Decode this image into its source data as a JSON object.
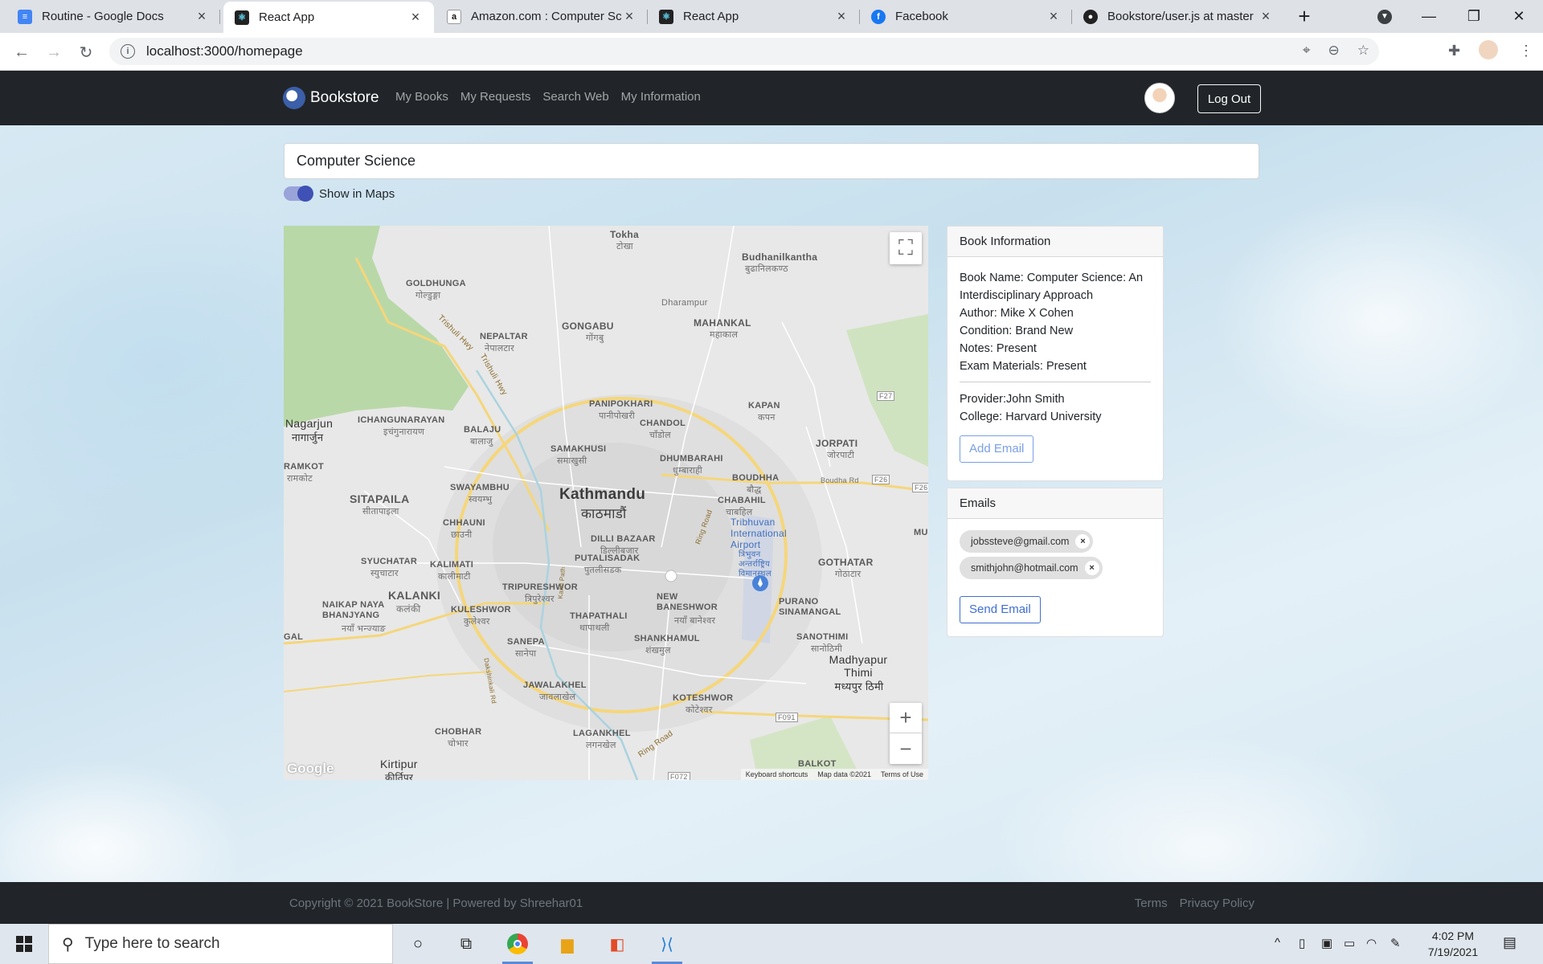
{
  "browser": {
    "tabs": [
      {
        "title": "Routine - Google Docs",
        "icon": "google-docs-icon",
        "color": "#4285f4"
      },
      {
        "title": "React App",
        "icon": "react-icon",
        "color": "#222222"
      },
      {
        "title": "Amazon.com : Computer Sc",
        "icon": "amazon-icon",
        "color": "#222222"
      },
      {
        "title": "React App",
        "icon": "react-icon",
        "color": "#222222"
      },
      {
        "title": "Facebook",
        "icon": "facebook-icon",
        "color": "#1877f2"
      },
      {
        "title": "Bookstore/user.js at master",
        "icon": "github-icon",
        "color": "#222222"
      }
    ],
    "url": "localhost:3000/homepage"
  },
  "nav": {
    "brand": "Bookstore",
    "links": [
      "My Books",
      "My Requests",
      "Search Web",
      "My Information"
    ],
    "logout": "Log Out"
  },
  "search": {
    "value": "Computer Science"
  },
  "toggle": {
    "label": "Show in Maps",
    "on": true
  },
  "map": {
    "labels": {
      "tokha": "Tokha",
      "tokha_dev": "टोखा",
      "budhanilkantha": "Budhanilkantha",
      "budhanilkantha_dev": "बुढानिलकण्ठ",
      "goldhunga": "GOLDHUNGA",
      "goldhunga_dev": "गोल्डुङ्गा",
      "dharampur": "Dharampur",
      "gongabu": "GONGABU",
      "gongabu_dev": "गोंगबु",
      "mahankal": "MAHANKAL",
      "mahankal_dev": "महाकाल",
      "nepaltar": "NEPALTAR",
      "nepaltar_dev": "नेपालटार",
      "trishuli1": "Trishuli Hwy",
      "trishuli2": "Trishuli Hwy",
      "panipokhari": "PANIPOKHARI",
      "panipokhari_dev": "पानीपोखरी",
      "kapan": "KAPAN",
      "kapan_dev": "कपन",
      "f27": "F27",
      "nagarjun": "Nagarjun",
      "nagarjun_dev": "नागार्जुन",
      "ichangunarayan": "ICHANGUNARAYAN",
      "ichangunarayan_dev": "इचंगुनारायण",
      "balaju": "BALAJU",
      "balaju_dev": "बालाजु",
      "chandol": "CHANDOL",
      "chandol_dev": "चाँडोल",
      "jorpati": "JORPATI",
      "jorpati_dev": "जोरपाटी",
      "samakhusi": "SAMAKHUSI",
      "samakhusi_dev": "समाखुसी",
      "dhumbarahi": "DHUMBARAHI",
      "dhumbarahi_dev": "धुम्बाराही",
      "ramkot": "RAMKOT",
      "ramkot_dev": "रामकोट",
      "swayambhu": "SWAYAMBHU",
      "swayambhu_dev": "स्वयम्भु",
      "boudhha": "BOUDHHA",
      "boudhha_dev": "बौद्ध",
      "boudha_rd": "Boudha Rd",
      "f26": "F26",
      "f26b": "F26",
      "kathmandu": "Kathmandu",
      "kathmandu_dev": "काठमाडौं",
      "sitapaila": "SITAPAILA",
      "sitapaila_dev": "सीतापाइला",
      "chabahil": "CHABAHIL",
      "chabahil_dev": "चाबहिल",
      "airport": "Tribhuvan International Airport",
      "airport_dev": "त्रिभुवन अन्तर्राष्ट्रिय विमानस्थल",
      "chhauni": "CHHAUNI",
      "chhauni_dev": "छाउनी",
      "dilli_bazaar": "DILLI BAZAAR",
      "dilli_bazaar_dev": "डिल्लीबजार",
      "mu": "MU",
      "syuchatar": "SYUCHATAR",
      "syuchatar_dev": "स्युचाटार",
      "kalimati": "KALIMATI",
      "kalimati_dev": "कालीमाटी",
      "putalisadak": "PUTALISADAK",
      "putalisadak_dev": "पुतलीसडक",
      "gothatar": "GOTHATAR",
      "gothatar_dev": "गोठाटार",
      "kalanki": "KALANKI",
      "kalanki_dev": "कलंकी",
      "tripureshwor": "TRIPURESHWOR",
      "tripureshwor_dev": "त्रिपुरेश्वर",
      "naikap": "NAIKAP NAYA BHANJYANG",
      "naikap_dev": "नयाँ भन्ज्याङ",
      "kuleshwor": "KULESHWOR",
      "kuleshwor_dev": "कुलेश्वर",
      "new_baneshwor": "NEW BANESHWOR",
      "new_baneshwor_dev": "नयाँ बानेश्वर",
      "purano": "PURANO SINAMANGAL",
      "thapathali": "THAPATHALI",
      "thapathali_dev": "थापाथली",
      "gal": "GAL",
      "sanepa": "SANEPA",
      "sanepa_dev": "सानेपा",
      "shankhamul": "SHANKHAMUL",
      "shankhamul_dev": "शंखमुल",
      "sanothimi": "SANOTHIMI",
      "sanothimi_dev": "सानोठिमी",
      "madhyapur": "Madhyapur Thimi",
      "madhyapur_dev": "मध्यपुर ठिमी",
      "jawalakhel": "JAWALAKHEL",
      "jawalakhel_dev": "जावलाखेल",
      "koteshwor": "KOTESHWOR",
      "koteshwor_dev": "कोटेश्वर",
      "f091": "F091",
      "f072": "F072",
      "chobhar": "CHOBHAR",
      "chobhar_dev": "चोभार",
      "lagankhel": "LAGANKHEL",
      "lagankhel_dev": "लगनखेल",
      "ring_road": "Ring Road",
      "ring_road2": "Ring Road",
      "balkot": "BALKOT",
      "kirtipur": "Kirtipur",
      "kirtipur_dev": "कीर्तिपुर",
      "dakshinkali": "Dakshinkali Rd",
      "kanti_path": "Kanti Path"
    },
    "google": "Google",
    "attribution": [
      "Keyboard shortcuts",
      "Map data ©2021",
      "Terms of Use"
    ],
    "zoom_in": "+",
    "zoom_out": "−",
    "fullscreen_icon": "fullscreen-icon"
  },
  "book_info": {
    "header": "Book Information",
    "book_name": "Book Name: Computer Science: An Interdisciplinary Approach",
    "author": "Author: Mike X Cohen",
    "condition": "Condition: Brand New",
    "notes": "Notes: Present",
    "exam": "Exam Materials: Present",
    "provider": "Provider:John Smith",
    "college": "College: Harvard University",
    "add_email": "Add Email"
  },
  "emails": {
    "header": "Emails",
    "list": [
      "jobssteve@gmail.com",
      "smithjohn@hotmail.com"
    ],
    "chip_delete": "×",
    "send": "Send Email"
  },
  "footer": {
    "copyright": "Copyright © 2021 BookStore | Powered by Shreehar01",
    "links": [
      "Terms",
      "Privacy Policy"
    ]
  },
  "taskbar": {
    "search_placeholder": "Type here to search",
    "time": "4:02 PM",
    "date": "7/19/2021"
  }
}
